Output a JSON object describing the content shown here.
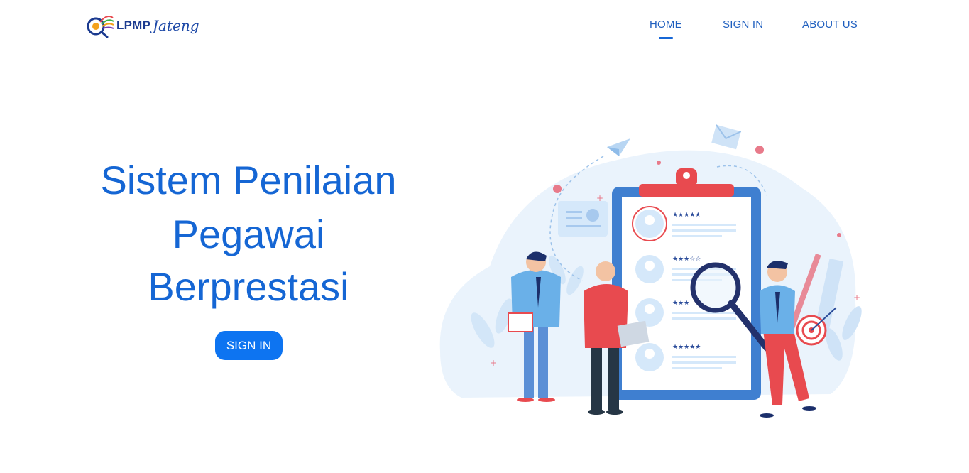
{
  "header": {
    "logo_text": "LPMP",
    "logo_script": "Jateng",
    "nav": [
      {
        "label": "HOME",
        "active": true
      },
      {
        "label": "SIGN IN",
        "active": false
      },
      {
        "label": "ABOUT US",
        "active": false
      }
    ]
  },
  "hero": {
    "line1": "Sistem Penilaian",
    "line2": "Pegawai",
    "line3": "Berprestasi",
    "button_label": "SIGN IN"
  },
  "colors": {
    "primary": "#1566d4",
    "button": "#0d74f1",
    "nav_text": "#1f5fbf",
    "illustration_bg": "#e8f2fc",
    "accent_red": "#e84a4f"
  },
  "icons": [
    "logo-icon",
    "paper-plane-icon",
    "envelope-icon",
    "magnifier-icon",
    "target-icon",
    "star-icon",
    "user-avatar-icon",
    "check-badge-icon"
  ]
}
